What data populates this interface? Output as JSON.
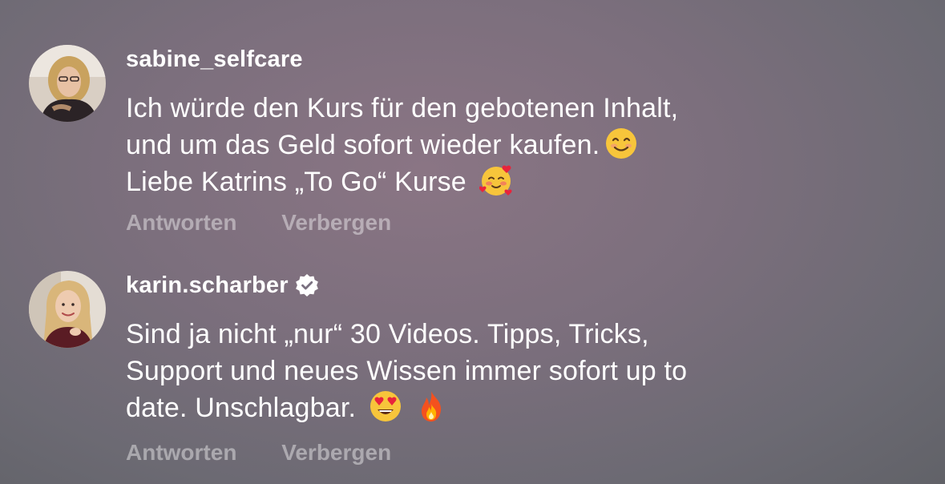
{
  "comments": [
    {
      "username": "sabine_selfcare",
      "verified": false,
      "lines": [
        "Ich würde den Kurs für den gebotenen Inhalt,",
        "und um das Geld sofort wieder kaufen.",
        "Liebe Katrins „To Go“ Kurse"
      ],
      "emojis": [
        "smiling-face-icon",
        "smiling-face-with-hearts-icon"
      ],
      "actions": {
        "reply": "Antworten",
        "hide": "Verbergen"
      }
    },
    {
      "username": "karin.scharber",
      "verified": true,
      "lines": [
        "Sind ja nicht „nur“ 30 Videos. Tipps, Tricks,",
        "Support und neues Wissen immer sofort up to",
        "date. Unschlagbar."
      ],
      "emojis": [
        "heart-eyes-icon",
        "fire-icon"
      ],
      "actions": {
        "reply": "Antworten",
        "hide": "Verbergen"
      }
    }
  ]
}
